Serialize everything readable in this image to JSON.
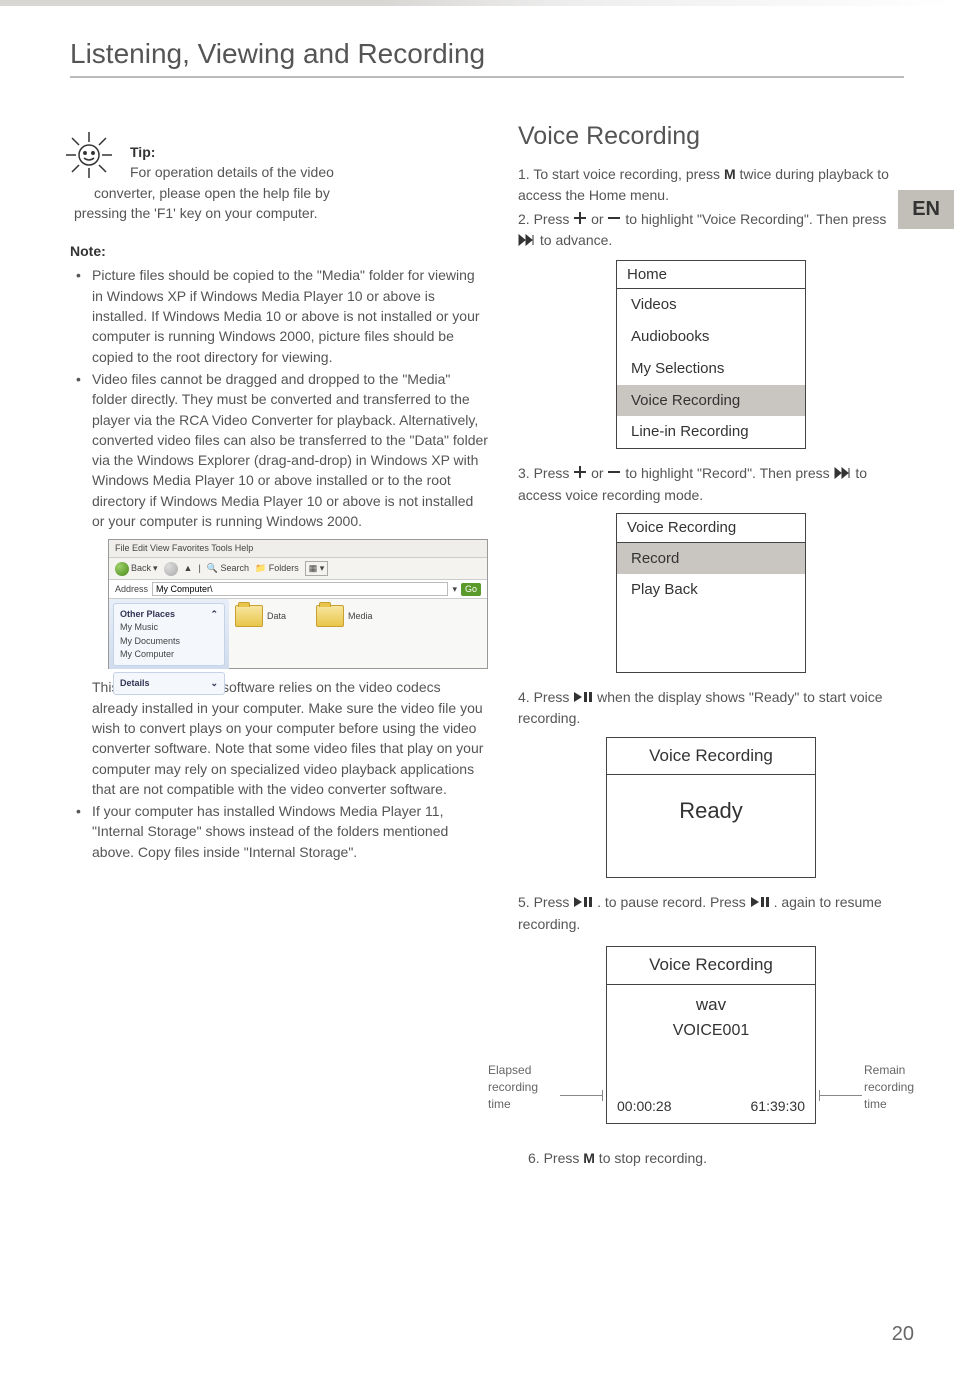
{
  "lang_tab": "EN",
  "page_number": "20",
  "section_title": "Listening, Viewing and Recording",
  "tip": {
    "label": "Tip:",
    "line1": "For operation details of the video",
    "line2": "converter, please open the help file by",
    "line3": "pressing the 'F1' key on your computer."
  },
  "note_label": "Note:",
  "notes": {
    "n1": "Picture files should be copied to the \"Media\" folder for viewing in Windows XP if Windows Media Player 10 or above is installed. If Windows Media 10 or above is not installed or your computer is running Windows 2000, picture files should be copied to the root directory for viewing.",
    "n2": "Video files cannot be dragged and dropped to the \"Media\" folder directly. They must be converted and transferred to the player via the RCA Video Converter for playback. Alternatively, converted video files can also be transferred  to the \"Data\" folder via the Windows Explorer (drag-and-drop) in Windows XP with Windows Media Player 10 or above installed or to the root directory if Windows Media Player 10 or above is not installed or your computer is running Windows 2000.",
    "n2b": "This video converter software relies on the video codecs already installed in your computer.  Make sure the video file you wish to convert plays on your computer before using the video converter software. Note that some video files that play on your computer may rely on specialized video playback applications that are not compatible with the video converter software.",
    "n3": "If your computer has installed Windows Media Player 11, \"Internal Storage\" shows instead of the folders mentioned above. Copy files inside \"Internal Storage\"."
  },
  "explorer": {
    "menus": "File   Edit   View   Favorites   Tools   Help",
    "back": "Back",
    "search": "Search",
    "folders": "Folders",
    "addr_label": "Address",
    "addr_value": "My Computer\\",
    "go": "Go",
    "other_places": "Other Places",
    "mymusic": "My Music",
    "mydocs": "My Documents",
    "mycomp": "My Computer",
    "details": "Details",
    "folder_data": "Data",
    "folder_media": "Media"
  },
  "vr": {
    "heading": "Voice Recording",
    "s1a": "1. To start voice recording, press ",
    "s1m": "M",
    "s1b": " twice during playback to access the Home menu.",
    "s2a": "2. Press ",
    "s2b": " or ",
    "s2c": " to highlight \"Voice Recording\". Then press ",
    "s2d": " to advance.",
    "menu1": {
      "title": "Home",
      "i1": "Videos",
      "i2": "Audiobooks",
      "i3": "My Selections",
      "i4": "Voice Recording",
      "i5": "Line-in Recording"
    },
    "s3a": "3. Press ",
    "s3b": " or ",
    "s3c": " to highlight \"Record\". Then press ",
    "s3d": " to access voice recording mode.",
    "menu2": {
      "title": "Voice Recording",
      "i1": "Record",
      "i2": "Play Back"
    },
    "s4a": "4. Press ",
    "s4b": " when the display shows \"Ready\" to start voice recording.",
    "disp1": {
      "title": "Voice Recording",
      "body": "Ready"
    },
    "s5a": "5. Press ",
    "s5b": " . to pause record. Press ",
    "s5c": " . again to resume recording.",
    "disp2": {
      "title": "Voice Recording",
      "fmt": "wav",
      "file": "VOICE001",
      "t1": "00:00:28",
      "t2": "61:39:30"
    },
    "elapsed": "Elapsed recording time",
    "remain": "Remain recording time",
    "s6a": "6. Press ",
    "s6m": "M",
    "s6b": " to stop recording."
  }
}
